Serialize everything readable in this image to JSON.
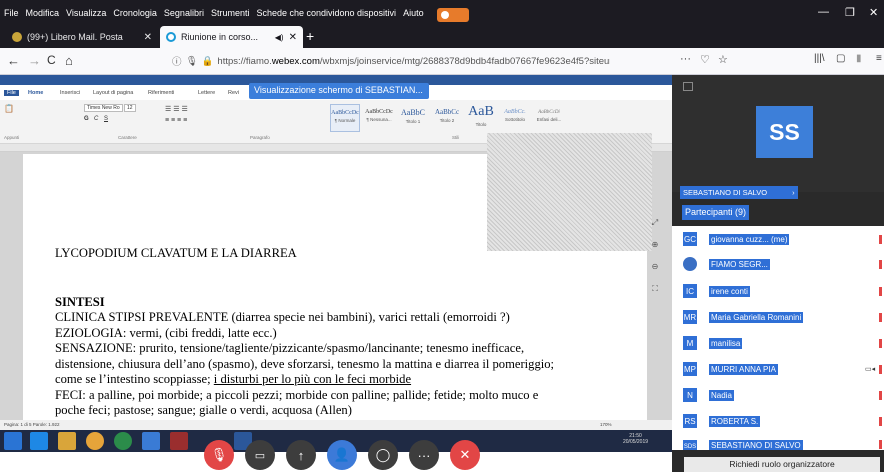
{
  "menubar": {
    "items": [
      "File",
      "Modifica",
      "Visualizza",
      "Cronologia",
      "Segnalibri",
      "Strumenti",
      "Schede che condividono dispositivi",
      "Aiuto"
    ],
    "window_controls": [
      "—",
      "❐",
      "✕"
    ]
  },
  "tabs": [
    {
      "label": "(99+) Libero Mail. Posta",
      "close": "✕"
    },
    {
      "label": "Riunione in corso...",
      "close": "✕",
      "audio": "◀)"
    }
  ],
  "new_tab": "+",
  "navbar": {
    "back": "←",
    "forward": "→",
    "reload": "C",
    "home": "⌂",
    "url_prefix": "https://fiamo.",
    "url_host": "webex.com",
    "url_path": "/wbxmjs/joinservice/mtg/2688378d9bdb4fadb07667fe9623e4f5?siteurl=fiamo",
    "overflow": "···",
    "right_icons": [
      "|||\\",
      "▢",
      "▮",
      "≡"
    ]
  },
  "word": {
    "share_banner": "Visualizzazione schermo di SEBASTIAN...",
    "ribbon_tabs": [
      "File",
      "Home",
      "Inserisci",
      "Layout di pagina",
      "Riferimenti",
      "Lettere",
      "Revi"
    ],
    "styles": [
      {
        "sample": "AaBbCcDc",
        "name": "¶ Normale"
      },
      {
        "sample": "AaBbCcDc",
        "name": "¶ Nessuna..."
      },
      {
        "sample": "AaBbC",
        "name": "Titolo 1"
      },
      {
        "sample": "AaBbCc",
        "name": "Titolo 2"
      },
      {
        "sample": "AaB",
        "name": "Titolo"
      },
      {
        "sample": "AaBbCc.",
        "name": "Sottotitolo"
      },
      {
        "sample": "AaBbCcDi",
        "name": "Enfasi deli..."
      }
    ],
    "groups": [
      "Appunti",
      "Carattere",
      "Paragrafo",
      "Stili"
    ],
    "font": "Times New Ro",
    "size": "12",
    "status": "Pagina: 1 di 5   Parole: 1.922",
    "zoom": "170%",
    "clock_time": "21:50",
    "clock_date": "20/05/2019"
  },
  "document": {
    "title": "LYCOPODIUM CLAVATUM E LA DIARREA",
    "heading": "SINTESI",
    "lines": [
      "CLINICA  STIPSI PREVALENTE (diarrea specie nei bambini), varici rettali (emorroidi ?)",
      "EZIOLOGIA: vermi, (cibi freddi, latte ecc.)",
      "SENSAZIONE:  prurito, tensione/tagliente/pizzicante/spasmo/lancinante;  tenesmo inefficace,",
      "distensione, chiusura dell’ano (spasmo), deve sforzarsi, tenesmo la mattina e diarrea il pomeriggio;"
    ],
    "line_plain": "come se l’intestino scoppiasse; ",
    "line_underlined": "i disturbi per lo più con le feci morbide",
    "lines_after": [
      "FECI: a palline, poi morbide; a piccoli pezzi; morbide con palline; pallide; fetide; molto muco e",
      "poche feci; pastose; sangue; gialle o verdi, acquosa (Allen)"
    ]
  },
  "controls": [
    "🎙",
    "▭",
    "↑",
    "👤",
    "◯",
    "···",
    "✕"
  ],
  "panel": {
    "avatar": "SS",
    "presenter": "SEBASTIANO DI SALVO",
    "presenter_suffix": "›",
    "participants_header": "Partecipanti (9)",
    "participants": [
      {
        "initials": "GC",
        "name": "giovanna cuzz...  (me)"
      },
      {
        "initials": "",
        "name": "FIAMO SEGR..."
      },
      {
        "initials": "IC",
        "name": "irene conti"
      },
      {
        "initials": "MR",
        "name": "Maria Gabriella Romanini"
      },
      {
        "initials": "M",
        "name": "manilisa"
      },
      {
        "initials": "MP",
        "name": "MURRI ANNA PIA"
      },
      {
        "initials": "N",
        "name": "Nadia"
      },
      {
        "initials": "RS",
        "name": "ROBERTA S."
      },
      {
        "initials": "SDS",
        "name": "SEBASTIANO DI SALVO"
      }
    ],
    "role_button": "Richiedi ruolo organizzatore"
  }
}
